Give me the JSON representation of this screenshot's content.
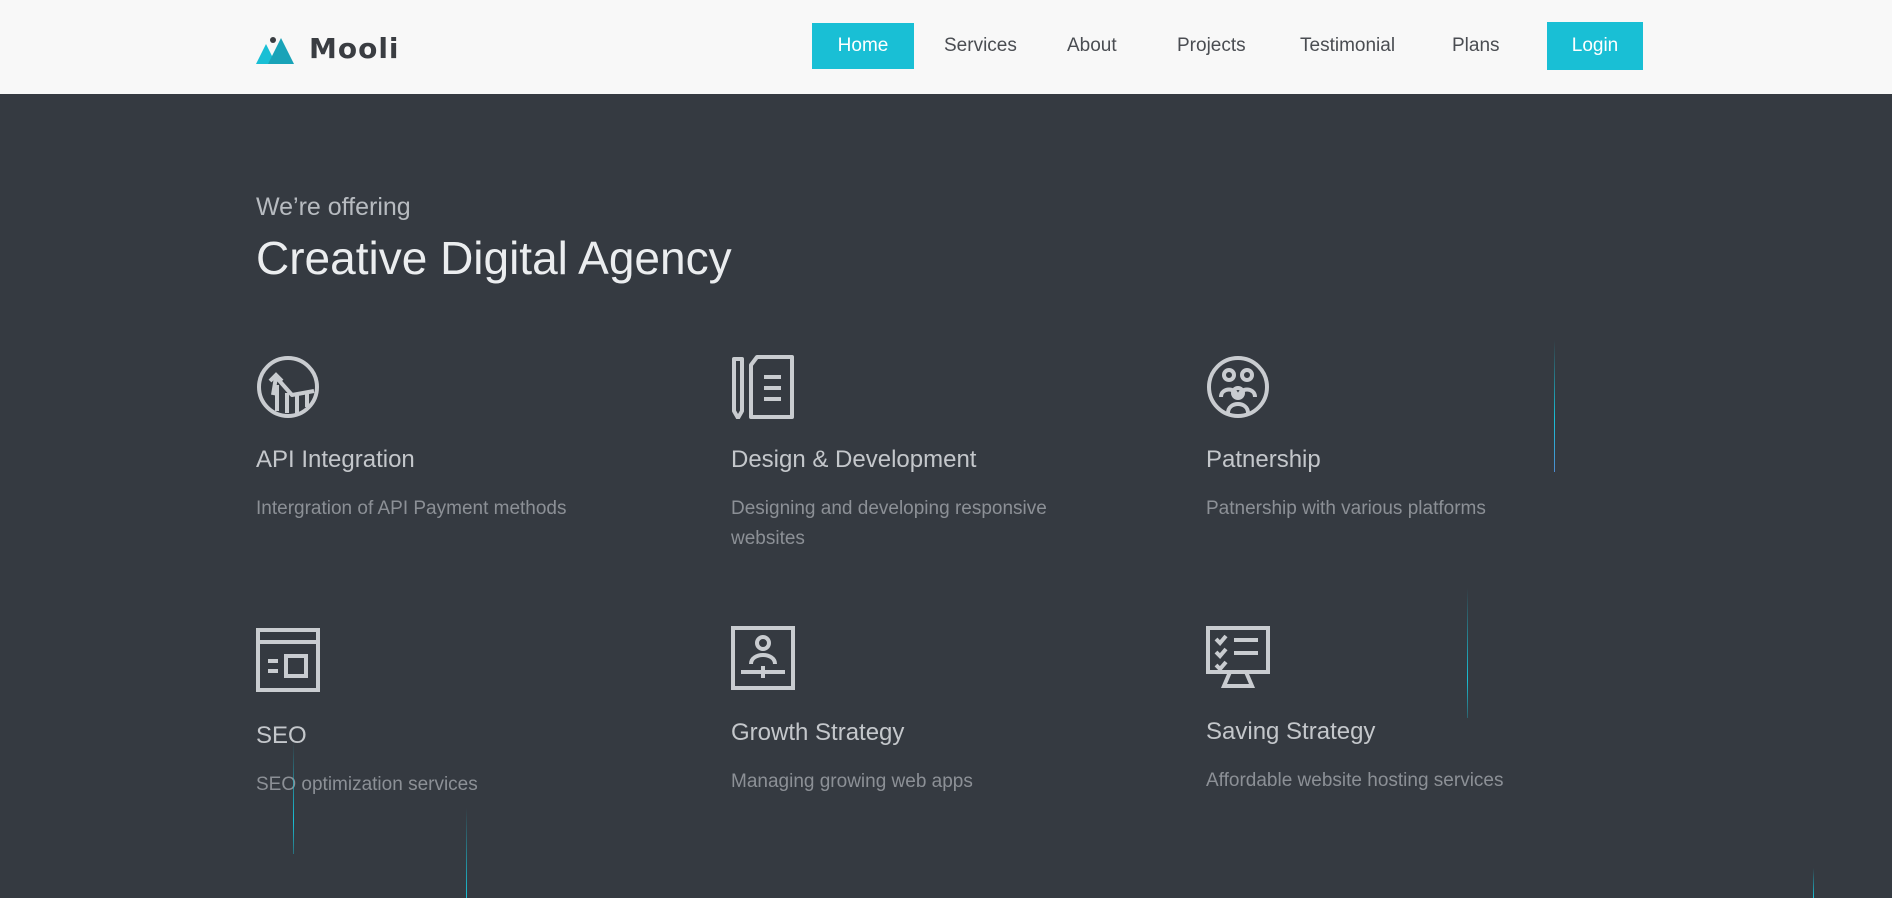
{
  "brand": {
    "name": "Mooli",
    "accent": "#19bfd5"
  },
  "nav": {
    "items": [
      "Home",
      "Services",
      "About",
      "Projects",
      "Testimonial",
      "Plans"
    ],
    "active": "Home",
    "login_label": "Login"
  },
  "hero": {
    "subtitle": "We’re offering",
    "title": "Creative Digital Agency"
  },
  "services": [
    {
      "icon": "chart-circle-icon",
      "title": "API Integration",
      "desc": "Intergration of API Payment methods"
    },
    {
      "icon": "document-pen-icon",
      "title": "Design & Development",
      "desc": "Designing and developing responsive websites"
    },
    {
      "icon": "people-circle-icon",
      "title": "Patnership",
      "desc": "Patnership with various platforms"
    },
    {
      "icon": "browser-window-icon",
      "title": "SEO",
      "desc": "SEO optimization services"
    },
    {
      "icon": "profile-frame-icon",
      "title": "Growth Strategy",
      "desc": "Managing growing web apps"
    },
    {
      "icon": "monitor-checklist-icon",
      "title": "Saving Strategy",
      "desc": "Affordable website hosting services"
    }
  ]
}
